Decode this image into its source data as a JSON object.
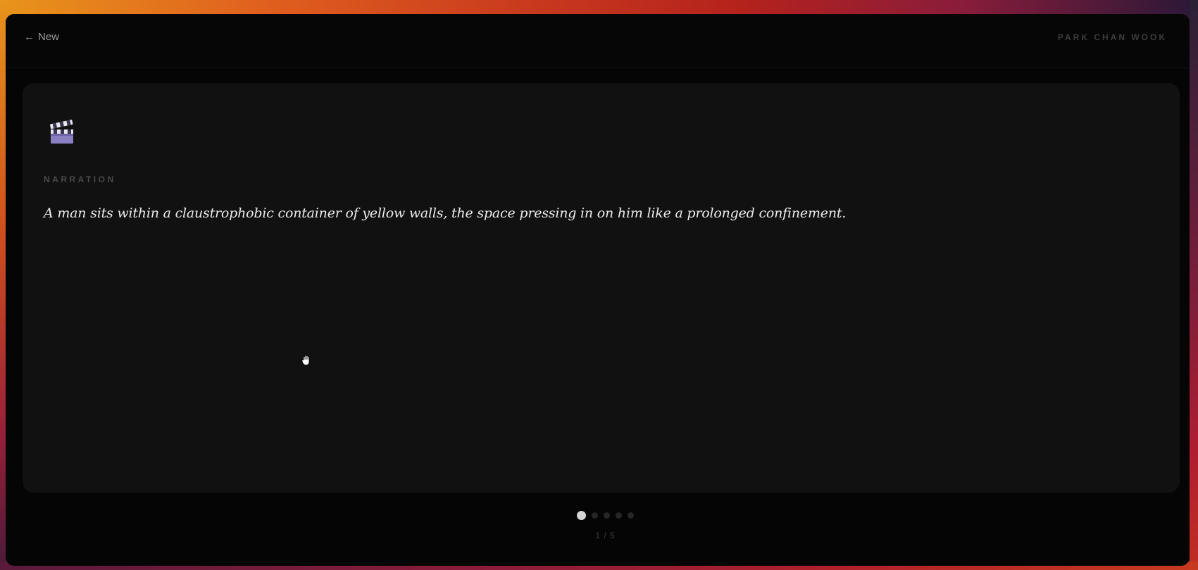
{
  "header": {
    "back_arrow": "←",
    "back_label": "New",
    "director": "PARK CHAN WOOK"
  },
  "scene": {
    "icon": "clapperboard-icon",
    "label": "NARRATION",
    "text": "A man sits within a claustrophobic container of yellow walls, the space pressing in on him like a prolonged confinement."
  },
  "pager": {
    "total": 5,
    "current": 1,
    "count_label": "1 / 5"
  },
  "colors": {
    "window_bg": "#050505",
    "card_bg": "#111111",
    "clapper": "#8a7fc0",
    "text": "#ececec"
  }
}
